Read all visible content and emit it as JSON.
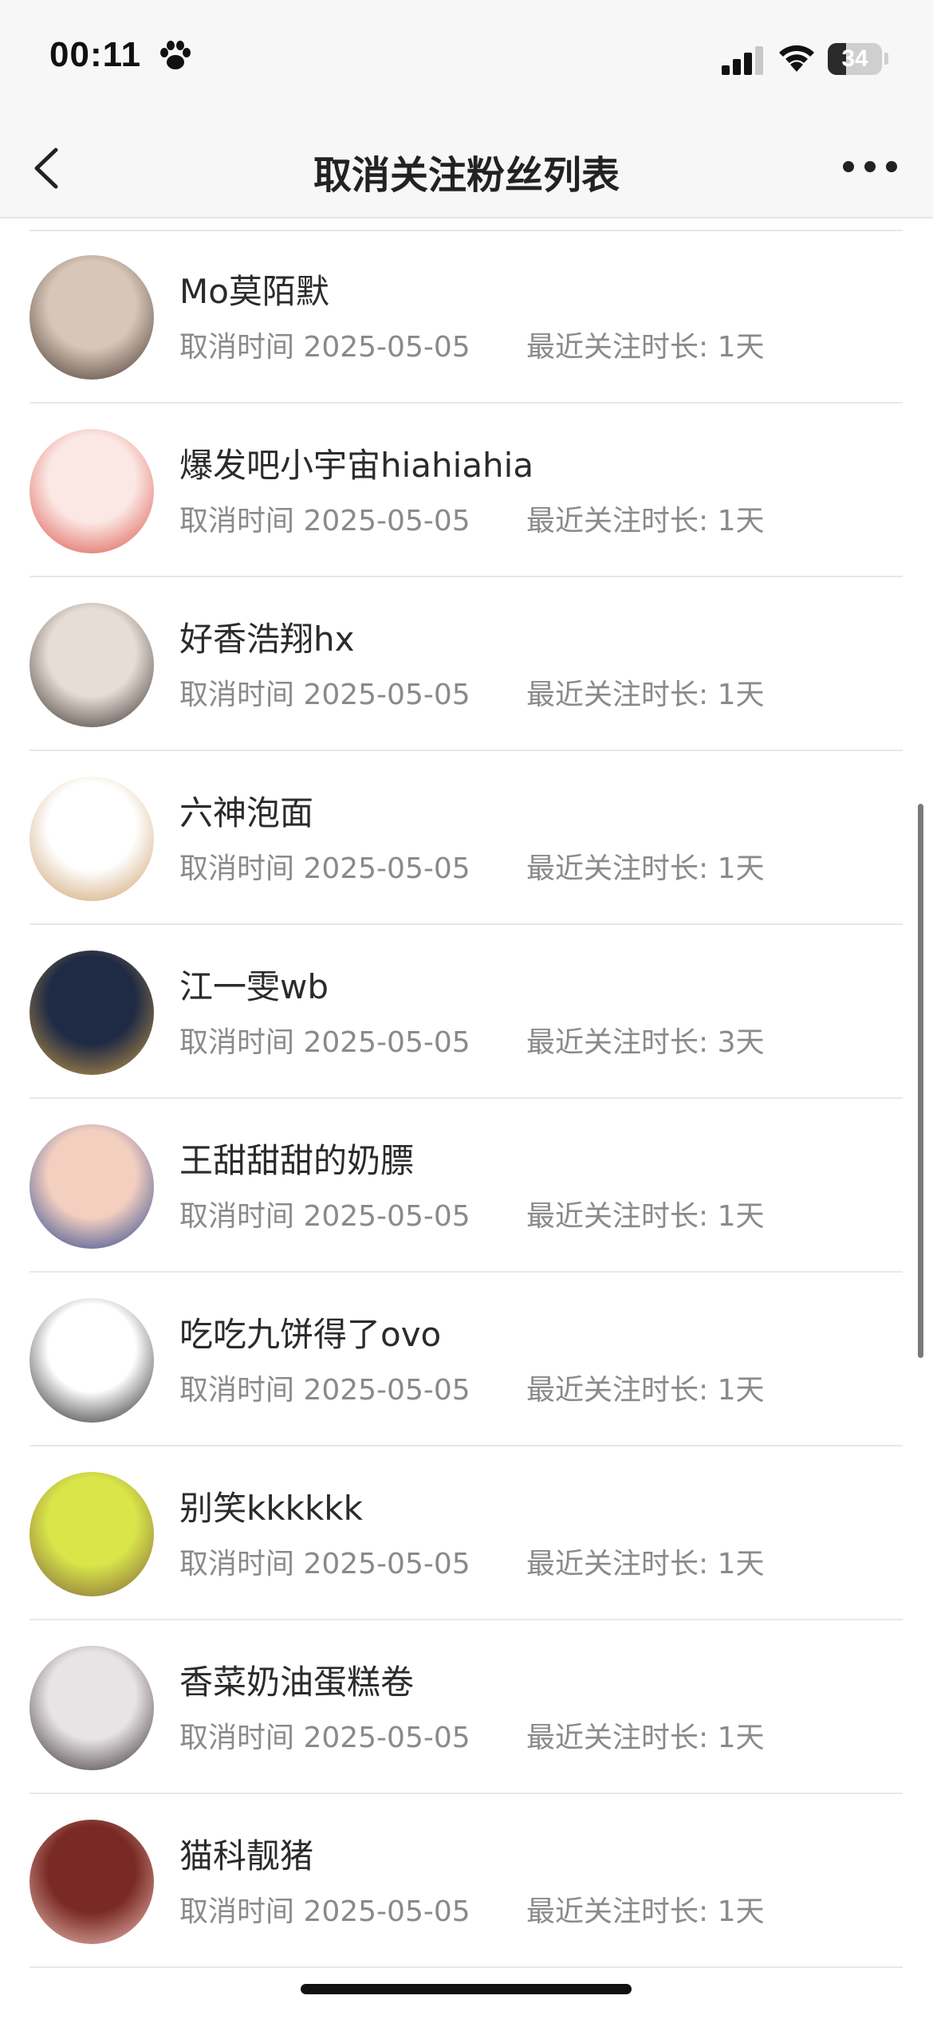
{
  "status_bar": {
    "time": "00:11",
    "battery": "34",
    "battery_level": 0.34,
    "icons": [
      "paw-icon",
      "cellular-signal-icon",
      "wifi-icon",
      "battery-icon"
    ]
  },
  "nav": {
    "title": "取消关注粉丝列表",
    "back_icon": "chevron-left-icon",
    "more_icon": "more-dots-icon"
  },
  "list": {
    "time_prefix": "取消时间",
    "duration_prefix": "最近关注时长:",
    "items": [
      {
        "name": "Mo莫陌默",
        "cancel_time": "2025-05-05",
        "duration": "1天",
        "avatar_colors": [
          "#d8c7b8",
          "#3a2b25"
        ]
      },
      {
        "name": "爆发吧小宇宙hiahiahia",
        "cancel_time": "2025-05-05",
        "duration": "1天",
        "avatar_colors": [
          "#fbe7e4",
          "#d8483a"
        ]
      },
      {
        "name": "好香浩翔hx",
        "cancel_time": "2025-05-05",
        "duration": "1天",
        "avatar_colors": [
          "#e7ddd7",
          "#2d2420"
        ]
      },
      {
        "name": "六神泡面",
        "cancel_time": "2025-05-05",
        "duration": "1天",
        "avatar_colors": [
          "#ffffff",
          "#c9975e"
        ]
      },
      {
        "name": "江一雯wb",
        "cancel_time": "2025-05-05",
        "duration": "3天",
        "avatar_colors": [
          "#1f2a44",
          "#d0a14a"
        ]
      },
      {
        "name": "王甜甜甜的奶膘",
        "cancel_time": "2025-05-05",
        "duration": "1天",
        "avatar_colors": [
          "#f3cfc0",
          "#1d3b8a"
        ]
      },
      {
        "name": "吃吃九饼得了ovo",
        "cancel_time": "2025-05-05",
        "duration": "1天",
        "avatar_colors": [
          "#ffffff",
          "#111111"
        ]
      },
      {
        "name": "别笑kkkkkk",
        "cancel_time": "2025-05-05",
        "duration": "1天",
        "avatar_colors": [
          "#d9e64a",
          "#7b5a3a"
        ]
      },
      {
        "name": "香菜奶油蛋糕卷",
        "cancel_time": "2025-05-05",
        "duration": "1天",
        "avatar_colors": [
          "#e8e4e6",
          "#2a2024"
        ]
      },
      {
        "name": "猫科靓猪",
        "cancel_time": "2025-05-05",
        "duration": "1天",
        "avatar_colors": [
          "#7a2a24",
          "#f4c9c2"
        ]
      }
    ]
  }
}
